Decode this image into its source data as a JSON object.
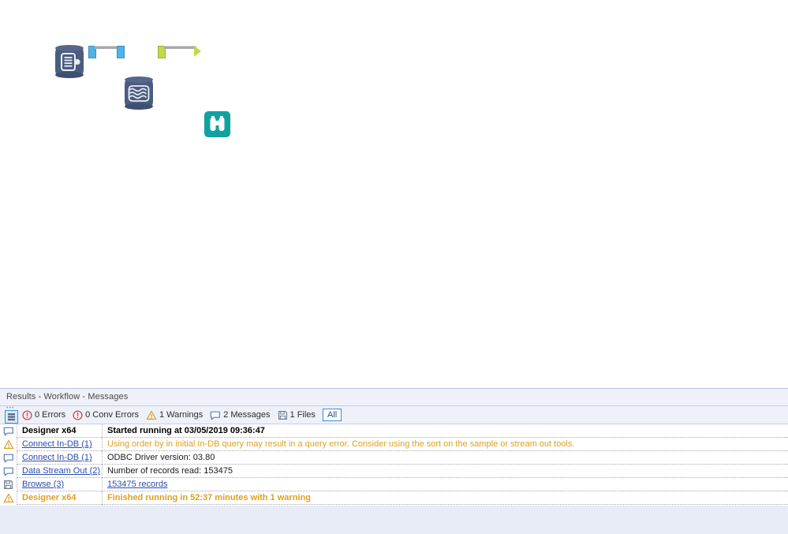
{
  "canvas": {
    "tools": [
      {
        "id": "connect-in-db",
        "name": "Connect In-DB",
        "type": "in-db-input",
        "color": "#4a5d7e"
      },
      {
        "id": "data-stream-out",
        "name": "Data Stream Out",
        "type": "in-db-stream-out",
        "color": "#4a5d7e"
      },
      {
        "id": "browse",
        "name": "Browse",
        "type": "browse",
        "color": "#10a2a0"
      }
    ],
    "connections": [
      {
        "from": "connect-in-db",
        "to": "data-stream-out",
        "anchor_color": "#4fb3e8",
        "kind": "in-db"
      },
      {
        "from": "data-stream-out",
        "to": "browse",
        "anchor_color": "#c2d94b",
        "kind": "standard"
      }
    ]
  },
  "results": {
    "title": "Results - Workflow - Messages",
    "toolbar": {
      "grip_icon": "list-view-icon",
      "filters": [
        {
          "icon": "error-icon",
          "label": "0 Errors",
          "color": "#d9453d"
        },
        {
          "icon": "conv-error-icon",
          "label": "0 Conv Errors",
          "color": "#d9453d"
        },
        {
          "icon": "warning-icon",
          "label": "1 Warnings",
          "color": "#e0a020"
        },
        {
          "icon": "message-icon",
          "label": "2 Messages",
          "color": "#5a7fb5"
        },
        {
          "icon": "file-icon",
          "label": "1 Files",
          "color": "#6b7c96"
        }
      ],
      "all_button": "All"
    },
    "messages": [
      {
        "icon": "message-icon",
        "tool": "Designer x64",
        "tool_style": "bold",
        "text": "Started running at 03/05/2019 09:36:47",
        "text_style": "bold"
      },
      {
        "icon": "warning-icon",
        "tool": "Connect In-DB (1)",
        "tool_style": "link",
        "text": "Using order by in initial In-DB query may result in a query error.  Consider using the sort on the sample or stream out tools.",
        "text_style": "warn"
      },
      {
        "icon": "message-icon",
        "tool": "Connect In-DB (1)",
        "tool_style": "link",
        "text": "ODBC Driver version: 03.80",
        "text_style": "plain"
      },
      {
        "icon": "message-icon",
        "tool": "Data Stream Out (2)",
        "tool_style": "link",
        "text": "Number of records read: 153475",
        "text_style": "plain"
      },
      {
        "icon": "file-icon",
        "tool": "Browse (3)",
        "tool_style": "link",
        "text": "153475 records",
        "text_style": "link"
      },
      {
        "icon": "warning-icon",
        "tool": "Designer x64",
        "tool_style": "warn-bold",
        "text": "Finished running in 52:37 minutes with 1 warning",
        "text_style": "warn-bold"
      }
    ]
  }
}
